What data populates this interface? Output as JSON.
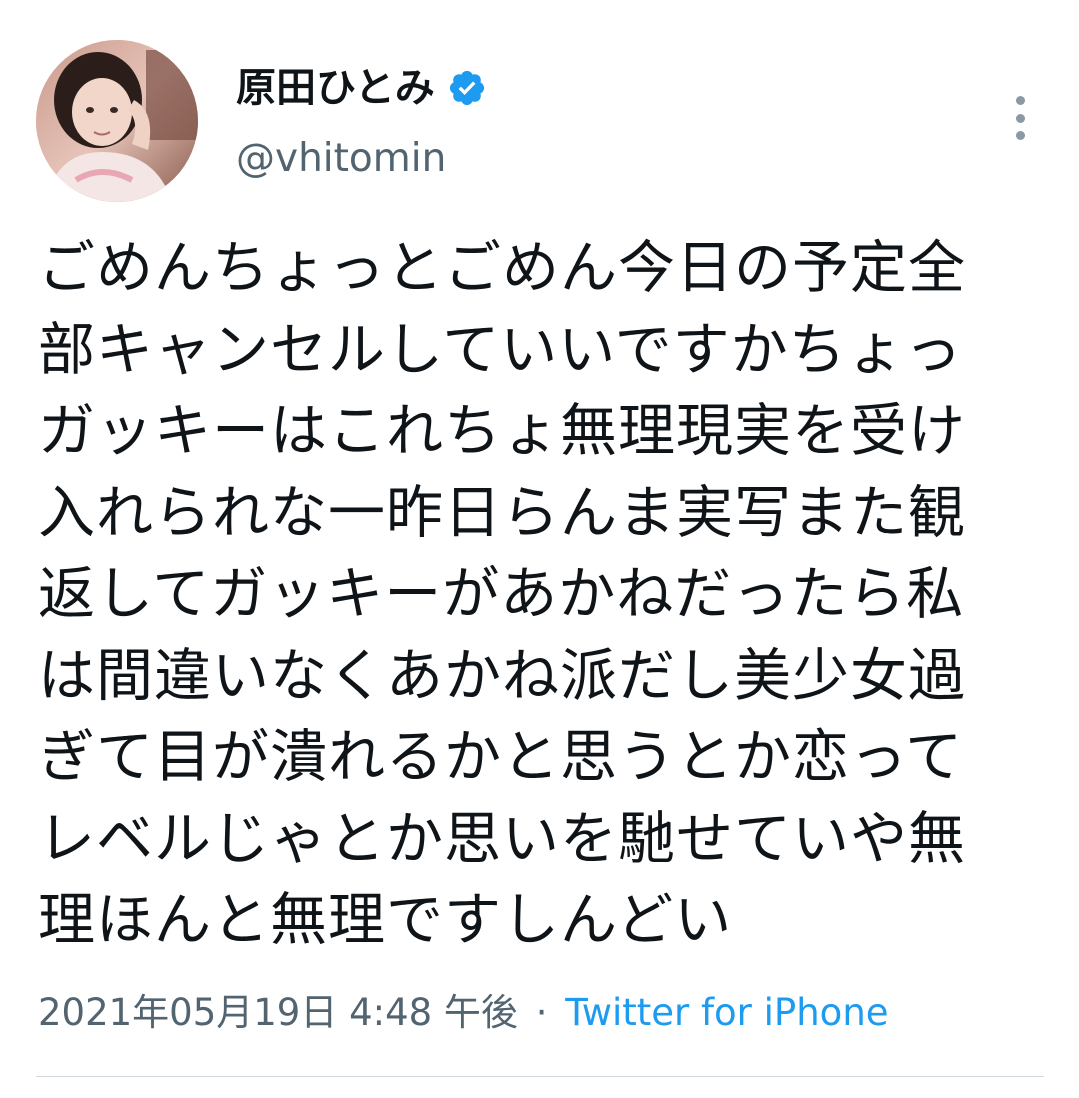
{
  "tweet": {
    "author": {
      "display_name": "原田ひとみ",
      "handle": "@vhitomin",
      "verified_icon": "verified-badge-icon"
    },
    "text_lines": [
      "ごめんちょっとごめん今日の予定全",
      "部キャンセルしていいですかちょっ",
      "ガッキーはこれちょ無理現実を受け",
      "入れられな一昨日らんま実写また観",
      "返してガッキーがあかねだったら私",
      "は間違いなくあかね派だし美少女過",
      "ぎて目が潰れるかと思うとか恋って",
      "レベルじゃとか思いを馳せていや無",
      "理ほんと無理ですしんどい"
    ],
    "timestamp": "2021年05月19日 4:48 午後",
    "separator": "·",
    "source": "Twitter for iPhone"
  },
  "colors": {
    "text": "#0f1419",
    "secondary": "#536471",
    "link": "#1d9bf0",
    "verified": "#1d9bf0",
    "divider": "#cfd9de"
  },
  "icons": {
    "more": "more-vertical-icon",
    "verified": "verified-badge-icon"
  }
}
